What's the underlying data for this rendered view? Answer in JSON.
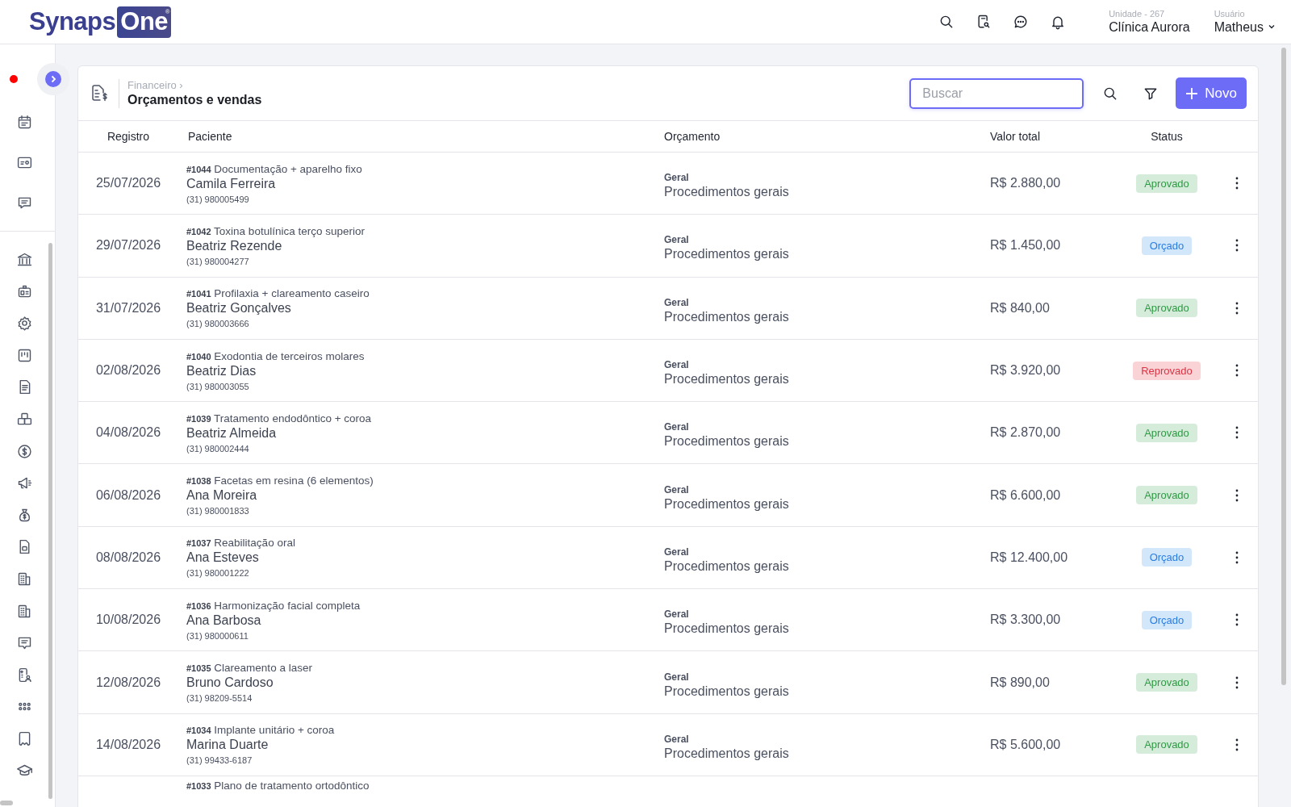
{
  "logo": {
    "part_1": "Synaps",
    "part_2": "One",
    "mark": "®"
  },
  "header": {
    "unit_label": "Unidade - 267",
    "unit_name": "Clínica Aurora",
    "user_label": "Usuário",
    "user_name": "Matheus"
  },
  "breadcrumb": {
    "parent": "Financeiro ›",
    "title": "Orçamentos e vendas"
  },
  "search": {
    "placeholder": "Buscar"
  },
  "new_button": {
    "label": "Novo"
  },
  "table": {
    "columns": [
      "Registro",
      "Paciente",
      "Orçamento",
      "Valor total",
      "Status"
    ],
    "rows": [
      {
        "date": "25/07/2026",
        "number": "#1044",
        "procedure": "Documentação + aparelho fixo",
        "patient": "Camila Ferreira",
        "phone": "(31) 980005499",
        "category": "Geral",
        "budget": "Procedimentos gerais",
        "total": "R$ 2.880,00",
        "status": {
          "label": "Aprovado",
          "kind": "approved"
        }
      },
      {
        "date": "29/07/2026",
        "number": "#1042",
        "procedure": "Toxina botulínica terço superior",
        "patient": "Beatriz Rezende",
        "phone": "(31) 980004277",
        "category": "Geral",
        "budget": "Procedimentos gerais",
        "total": "R$ 1.450,00",
        "status": {
          "label": "Orçado",
          "kind": "quoted"
        }
      },
      {
        "date": "31/07/2026",
        "number": "#1041",
        "procedure": "Profilaxia + clareamento caseiro",
        "patient": "Beatriz Gonçalves",
        "phone": "(31) 980003666",
        "category": "Geral",
        "budget": "Procedimentos gerais",
        "total": "R$ 840,00",
        "status": {
          "label": "Aprovado",
          "kind": "approved"
        }
      },
      {
        "date": "02/08/2026",
        "number": "#1040",
        "procedure": "Exodontia de terceiros molares",
        "patient": "Beatriz Dias",
        "phone": "(31) 980003055",
        "category": "Geral",
        "budget": "Procedimentos gerais",
        "total": "R$ 3.920,00",
        "status": {
          "label": "Reprovado",
          "kind": "rejected"
        }
      },
      {
        "date": "04/08/2026",
        "number": "#1039",
        "procedure": "Tratamento endodôntico + coroa",
        "patient": "Beatriz Almeida",
        "phone": "(31) 980002444",
        "category": "Geral",
        "budget": "Procedimentos gerais",
        "total": "R$ 2.870,00",
        "status": {
          "label": "Aprovado",
          "kind": "approved"
        }
      },
      {
        "date": "06/08/2026",
        "number": "#1038",
        "procedure": "Facetas em resina (6 elementos)",
        "patient": "Ana Moreira",
        "phone": "(31) 980001833",
        "category": "Geral",
        "budget": "Procedimentos gerais",
        "total": "R$ 6.600,00",
        "status": {
          "label": "Aprovado",
          "kind": "approved"
        }
      },
      {
        "date": "08/08/2026",
        "number": "#1037",
        "procedure": "Reabilitação oral",
        "patient": "Ana Esteves",
        "phone": "(31) 980001222",
        "category": "Geral",
        "budget": "Procedimentos gerais",
        "total": "R$ 12.400,00",
        "status": {
          "label": "Orçado",
          "kind": "quoted"
        }
      },
      {
        "date": "10/08/2026",
        "number": "#1036",
        "procedure": "Harmonização facial completa",
        "patient": "Ana Barbosa",
        "phone": "(31) 980000611",
        "category": "Geral",
        "budget": "Procedimentos gerais",
        "total": "R$ 3.300,00",
        "status": {
          "label": "Orçado",
          "kind": "quoted"
        }
      },
      {
        "date": "12/08/2026",
        "number": "#1035",
        "procedure": "Clareamento a laser",
        "patient": "Bruno Cardoso",
        "phone": "(31) 98209-5514",
        "category": "Geral",
        "budget": "Procedimentos gerais",
        "total": "R$ 890,00",
        "status": {
          "label": "Aprovado",
          "kind": "approved"
        }
      },
      {
        "date": "14/08/2026",
        "number": "#1034",
        "procedure": "Implante unitário + coroa",
        "patient": "Marina Duarte",
        "phone": "(31) 99433-6187",
        "category": "Geral",
        "budget": "Procedimentos gerais",
        "total": "R$ 5.600,00",
        "status": {
          "label": "Aprovado",
          "kind": "approved"
        }
      }
    ],
    "partial_row": {
      "number": "#1033",
      "procedure": "Plano de tratamento ortodôntico"
    }
  }
}
